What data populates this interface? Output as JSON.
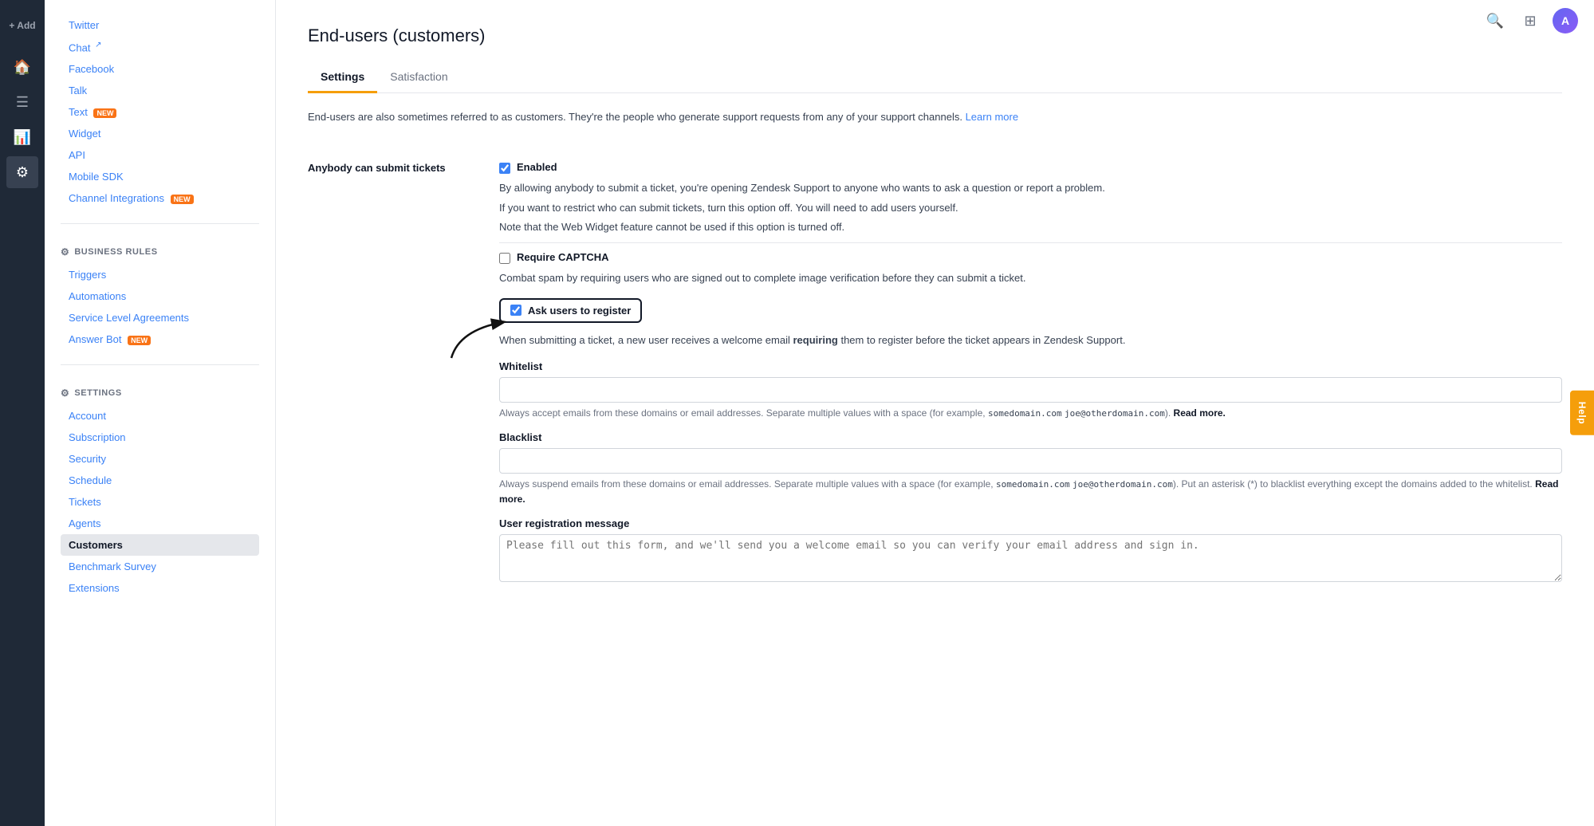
{
  "topbar": {
    "search_icon": "🔍",
    "apps_icon": "⊞",
    "avatar_text": "A"
  },
  "rail": {
    "add_label": "+ Add",
    "items": [
      {
        "name": "home",
        "icon": "⌂",
        "active": false
      },
      {
        "name": "tickets",
        "icon": "☰",
        "active": false
      },
      {
        "name": "reports",
        "icon": "📊",
        "active": false
      },
      {
        "name": "settings",
        "icon": "⚙",
        "active": true
      }
    ]
  },
  "sidebar": {
    "channels_items": [
      {
        "id": "twitter",
        "label": "Twitter",
        "badge": null,
        "external": false
      },
      {
        "id": "chat",
        "label": "Chat",
        "badge": null,
        "external": true
      },
      {
        "id": "facebook",
        "label": "Facebook",
        "badge": null,
        "external": false
      },
      {
        "id": "talk",
        "label": "Talk",
        "badge": null,
        "external": false
      },
      {
        "id": "text",
        "label": "Text",
        "badge": "NEW",
        "external": false
      },
      {
        "id": "widget",
        "label": "Widget",
        "badge": null,
        "external": false
      },
      {
        "id": "api",
        "label": "API",
        "badge": null,
        "external": false
      },
      {
        "id": "mobile-sdk",
        "label": "Mobile SDK",
        "badge": null,
        "external": false
      },
      {
        "id": "channel-integrations",
        "label": "Channel Integrations",
        "badge": "NEW",
        "external": false
      }
    ],
    "business_rules_label": "BUSINESS RULES",
    "business_rules_items": [
      {
        "id": "triggers",
        "label": "Triggers"
      },
      {
        "id": "automations",
        "label": "Automations"
      },
      {
        "id": "sla",
        "label": "Service Level Agreements"
      },
      {
        "id": "answer-bot",
        "label": "Answer Bot",
        "badge": "NEW"
      }
    ],
    "settings_label": "SETTINGS",
    "settings_items": [
      {
        "id": "account",
        "label": "Account"
      },
      {
        "id": "subscription",
        "label": "Subscription"
      },
      {
        "id": "security",
        "label": "Security"
      },
      {
        "id": "schedule",
        "label": "Schedule"
      },
      {
        "id": "tickets",
        "label": "Tickets"
      },
      {
        "id": "agents",
        "label": "Agents"
      },
      {
        "id": "customers",
        "label": "Customers",
        "active": true
      },
      {
        "id": "benchmark-survey",
        "label": "Benchmark Survey"
      },
      {
        "id": "extensions",
        "label": "Extensions"
      }
    ]
  },
  "main": {
    "page_title": "End-users (customers)",
    "tabs": [
      {
        "id": "settings",
        "label": "Settings",
        "active": true
      },
      {
        "id": "satisfaction",
        "label": "Satisfaction",
        "active": false
      }
    ],
    "intro_text": "End-users are also sometimes referred to as customers. They're the people who generate support requests from any of your support channels.",
    "intro_link": "Learn more",
    "section1": {
      "label": "Anybody can submit\ntickets",
      "enabled_label": "Enabled",
      "enabled_desc1": "By allowing anybody to submit a ticket, you're opening Zendesk Support to anyone who wants to ask a question or report a problem.",
      "enabled_desc2": "If you want to restrict who can submit tickets, turn this option off. You will need to add users yourself.",
      "enabled_desc3": "Note that the Web Widget feature cannot be used if this option is turned off.",
      "captcha_label": "Require CAPTCHA",
      "captcha_desc": "Combat spam by requiring users who are signed out to complete image verification before they can submit a ticket.",
      "register_label": "Ask users to register",
      "register_desc_pre": "When submitting a ticket, a new user receives a welcome email ",
      "register_desc_bold": "requiring",
      "register_desc_post": " them to register before the ticket appears in Zendesk Support.",
      "whitelist_label": "Whitelist",
      "whitelist_placeholder": "",
      "whitelist_desc_pre": "Always accept emails from these domains or email addresses. Separate multiple values with a space (for example, ",
      "whitelist_code1": "somedomain.com",
      "whitelist_code2": "joe@otherdomain.com",
      "whitelist_desc_post": "). ",
      "whitelist_read_more": "Read more.",
      "blacklist_label": "Blacklist",
      "blacklist_placeholder": "",
      "blacklist_desc_pre": "Always suspend emails from these domains or email addresses. Separate multiple values with a space (for example, ",
      "blacklist_code1": "somedomain.com",
      "blacklist_code2": "joe@otherdomain.com",
      "blacklist_desc_mid": "). Put an asterisk (*) to blacklist everything except the domains added to the whitelist. ",
      "blacklist_read_more": "Read more.",
      "reg_message_label": "User registration message",
      "reg_message_placeholder": "Please fill out this form, and we'll send you a welcome email so you can verify your email address and sign in."
    },
    "help_button": "Help"
  }
}
